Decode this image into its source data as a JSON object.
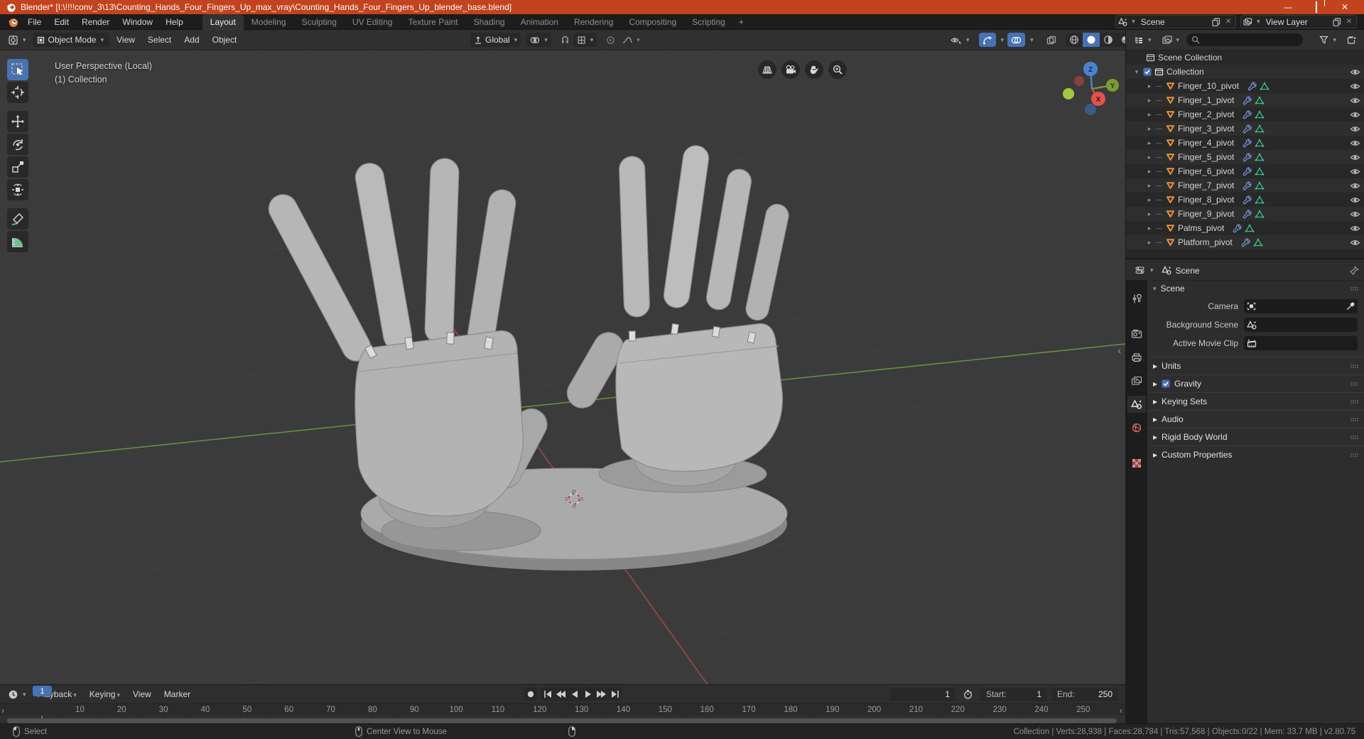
{
  "window": {
    "title": "Blender* [I:\\!!!!conv_3\\13\\Counting_Hands_Four_Fingers_Up_max_vray\\Counting_Hands_Four_Fingers_Up_blender_base.blend]"
  },
  "menubar": {
    "menus": [
      "File",
      "Edit",
      "Render",
      "Window",
      "Help"
    ]
  },
  "workspaces": {
    "tabs": [
      "Layout",
      "Modeling",
      "Sculpting",
      "UV Editing",
      "Texture Paint",
      "Shading",
      "Animation",
      "Rendering",
      "Compositing",
      "Scripting"
    ],
    "active": "Layout",
    "add_tab": "+"
  },
  "scene_selector": {
    "label": "Scene"
  },
  "view_layer_selector": {
    "label": "View Layer"
  },
  "viewport_header": {
    "mode": "Object Mode",
    "menus": [
      "View",
      "Select",
      "Add",
      "Object"
    ],
    "orientation": "Global"
  },
  "viewport": {
    "overlay_line1": "User Perspective (Local)",
    "overlay_line2": "(1) Collection",
    "gizmo": {
      "x": "X",
      "y": "Y",
      "z": "Z"
    },
    "sidebar_toggle": "‹"
  },
  "outliner": {
    "root": "Scene Collection",
    "collection": "Collection",
    "objects": [
      "Finger_10_pivot",
      "Finger_1_pivot",
      "Finger_2_pivot",
      "Finger_3_pivot",
      "Finger_4_pivot",
      "Finger_5_pivot",
      "Finger_6_pivot",
      "Finger_7_pivot",
      "Finger_8_pivot",
      "Finger_9_pivot",
      "Palms_pivot",
      "Platform_pivot"
    ]
  },
  "properties": {
    "breadcrumb": "Scene",
    "scene_panel_title": "Scene",
    "camera_label": "Camera",
    "background_label": "Background Scene",
    "movie_clip_label": "Active Movie Clip",
    "collapsed_panels": [
      "Units",
      "Gravity",
      "Keying Sets",
      "Audio",
      "Rigid Body World",
      "Custom Properties"
    ]
  },
  "timeline": {
    "menus": [
      "Playback",
      "Keying",
      "View",
      "Marker"
    ],
    "current_frame": "1",
    "start_label": "Start:",
    "start_value": "1",
    "end_label": "End:",
    "end_value": "250",
    "ruler_frames": [
      10,
      20,
      30,
      40,
      50,
      60,
      70,
      80,
      90,
      100,
      110,
      120,
      130,
      140,
      150,
      160,
      170,
      180,
      190,
      200,
      210,
      220,
      230,
      240,
      250
    ]
  },
  "statusbar": {
    "left_hint": "Select",
    "middle_hint": "Center View to Mouse",
    "stats": "Collection | Verts:28,938 | Faces:28,784 | Tris:57,568 | Objects:0/22 | Mem: 33.7 MB | v2.80.75"
  },
  "colors": {
    "titlebar": "#C2431E",
    "accent_blue": "#4772b3",
    "axis_green": "#6E9D3C",
    "axis_red": "#A84A42",
    "object_orange": "#E8913C",
    "data_green": "#3DBD8E",
    "modifier_blue": "#708FD1"
  }
}
